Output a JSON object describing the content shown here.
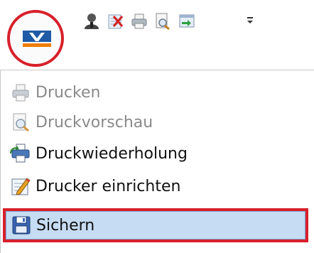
{
  "quick_access_toolbar": {
    "app_button": {
      "icon": "volksbank-logo-icon"
    },
    "icons": [
      {
        "name": "user-icon"
      },
      {
        "name": "delete-document-icon"
      },
      {
        "name": "print-icon"
      },
      {
        "name": "print-preview-icon"
      },
      {
        "name": "export-icon"
      }
    ],
    "customize_icon": "chevron-down-icon"
  },
  "menu": {
    "items": [
      {
        "label": "Drucken",
        "icon": "printer-icon",
        "enabled": false
      },
      {
        "label": "Druckvorschau",
        "icon": "print-preview-icon",
        "enabled": false
      },
      {
        "label": "Druckwiederholung",
        "icon": "reprint-icon",
        "enabled": true
      },
      {
        "label": "Drucker einrichten",
        "icon": "printer-setup-icon",
        "enabled": true
      },
      {
        "label": "Sichern",
        "icon": "save-icon",
        "enabled": true,
        "highlighted": true
      }
    ]
  },
  "colors": {
    "highlight_border": "#d8202a",
    "selection_background": "#c6dcf2",
    "logo_blue": "#1f5aa6",
    "logo_orange": "#ee7d00"
  }
}
